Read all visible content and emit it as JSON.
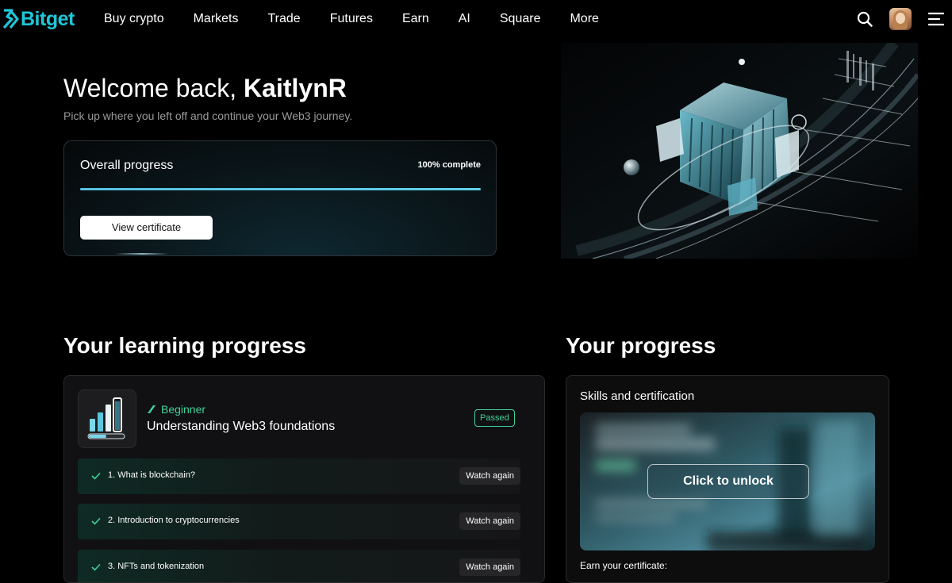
{
  "nav": {
    "logo_text": "Bitget",
    "links": [
      "Buy crypto",
      "Markets",
      "Trade",
      "Futures",
      "Earn",
      "AI",
      "Square",
      "More"
    ]
  },
  "hero": {
    "greeting": "Welcome back, ",
    "username": "KaitlynR",
    "subtitle": "Pick up where you left off and continue your Web3 journey."
  },
  "overall": {
    "title": "Overall progress",
    "complete_label": "100% complete",
    "progress": 1.0,
    "button_label": "View certificate"
  },
  "learning": {
    "section_title": "Your learning progress",
    "course": {
      "level": "Beginner",
      "title": "Understanding Web3 foundations",
      "status": "Passed"
    },
    "lessons": [
      {
        "title": "1. What is blockchain?",
        "action": "Watch again"
      },
      {
        "title": "2. Introduction to cryptocurrencies",
        "action": "Watch again"
      },
      {
        "title": "3. NFTs and tokenization",
        "action": "Watch again"
      }
    ]
  },
  "progress_panel": {
    "section_title": "Your progress",
    "skills_title": "Skills and certification",
    "unlock_label": "Click to unlock",
    "earn_label": "Earn your certificate:"
  },
  "colors": {
    "brand": "#1fc6d8",
    "accent_green": "#3fd39b",
    "progress_fill": "#5fd0ea"
  }
}
